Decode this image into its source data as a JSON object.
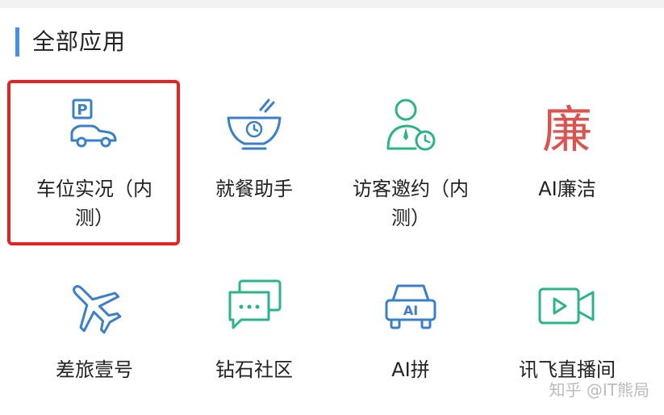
{
  "section": {
    "title": "全部应用"
  },
  "apps": [
    {
      "label": "车位实况（内",
      "label2": "测）",
      "icon": "parking-car-icon"
    },
    {
      "label": "就餐助手",
      "icon": "dining-bowl-icon"
    },
    {
      "label": "访客邀约（内",
      "label2": "测）",
      "icon": "visitor-clock-icon"
    },
    {
      "label": "AI廉洁",
      "icon": "lian-character-icon"
    },
    {
      "label": "差旅壹号",
      "icon": "airplane-icon"
    },
    {
      "label": "钻石社区",
      "icon": "chat-bubbles-icon"
    },
    {
      "label": "AI拼",
      "icon": "ai-car-icon"
    },
    {
      "label": "讯飞直播间",
      "icon": "video-camera-icon"
    }
  ],
  "watermark": "知乎 @IT熊局",
  "colors": {
    "accent_blue": "#4a90e2",
    "icon_blue": "#3b7fc9",
    "icon_green": "#2bb38b",
    "icon_red": "#d9534f",
    "highlight_red": "#e52323"
  }
}
